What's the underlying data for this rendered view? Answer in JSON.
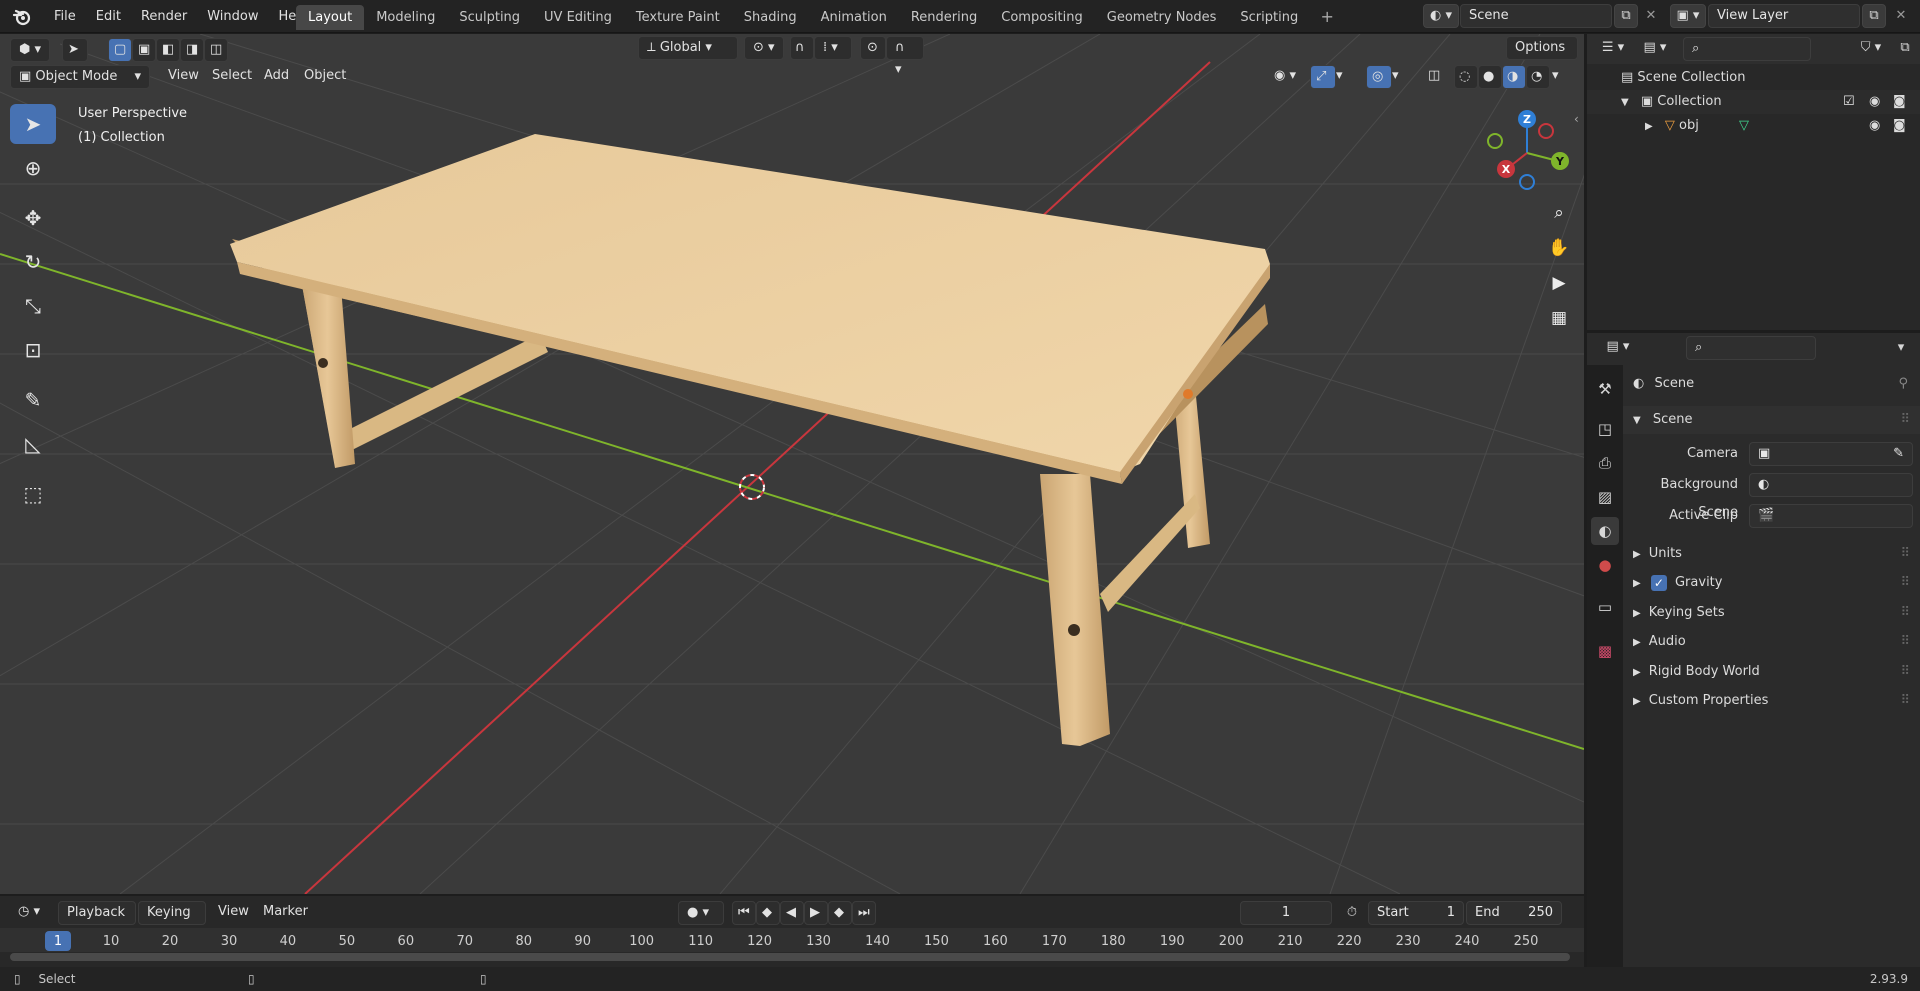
{
  "topbar": {
    "logo_icon": "blender-logo-icon",
    "menus": [
      "File",
      "Edit",
      "Render",
      "Window",
      "Help"
    ],
    "workspaces": [
      "Layout",
      "Modeling",
      "Sculpting",
      "UV Editing",
      "Texture Paint",
      "Shading",
      "Animation",
      "Rendering",
      "Compositing",
      "Geometry Nodes",
      "Scripting"
    ],
    "active_workspace": "Layout",
    "scene_name": "Scene",
    "view_layer": "View Layer"
  },
  "viewport_header": {
    "mode": "Object Mode",
    "menus": [
      "View",
      "Select",
      "Add",
      "Object"
    ],
    "transform_orientation": "Global",
    "options_label": "Options"
  },
  "viewport": {
    "overlay_line1": "User Perspective",
    "overlay_line2": "(1) Collection",
    "gizmo_axes": [
      "Z",
      "Y",
      "X"
    ],
    "colors": {
      "x_axis": "#c8363d",
      "y_axis": "#7fb52b",
      "z_axis": "#2f7fd6",
      "background": "#3a3a3a"
    }
  },
  "outliner": {
    "root": "Scene Collection",
    "collection": "Collection",
    "object": "obj"
  },
  "properties": {
    "header": "Scene",
    "panel": "Scene",
    "fields": [
      {
        "label": "Camera",
        "value": ""
      },
      {
        "label": "Background Scene",
        "value": ""
      },
      {
        "label": "Active Clip",
        "value": ""
      }
    ],
    "sections": [
      "Units",
      "Gravity",
      "Keying Sets",
      "Audio",
      "Rigid Body World",
      "Custom Properties"
    ],
    "gravity_checked": true
  },
  "timeline": {
    "menus": [
      "Playback",
      "Keying",
      "View",
      "Marker"
    ],
    "current_frame": "1",
    "start_label": "Start",
    "start": "1",
    "end_label": "End",
    "end": "250",
    "ruler": [
      "1",
      "10",
      "20",
      "30",
      "40",
      "50",
      "60",
      "70",
      "80",
      "90",
      "100",
      "110",
      "120",
      "130",
      "140",
      "150",
      "160",
      "170",
      "180",
      "190",
      "200",
      "210",
      "220",
      "230",
      "240",
      "250"
    ]
  },
  "status": {
    "action": "Select",
    "version": "2.93.9"
  }
}
